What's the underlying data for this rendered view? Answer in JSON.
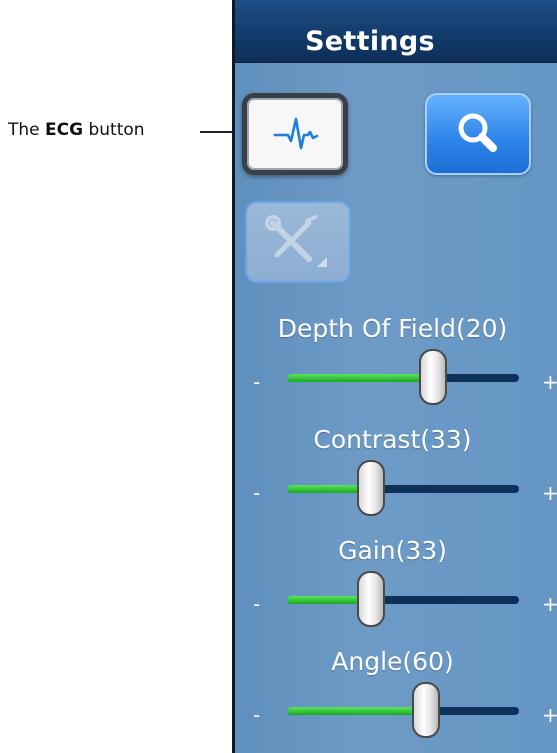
{
  "callout": {
    "prefix": "The ",
    "bold": "ECG",
    "suffix": " button"
  },
  "panel": {
    "title": "Settings"
  },
  "buttons": {
    "ecg": {
      "icon": "ecg-waveform-icon",
      "color": "#1e7fd8"
    },
    "search": {
      "icon": "magnifier-icon"
    },
    "tools": {
      "icon": "wrench-screwdriver-icon"
    }
  },
  "sliders": [
    {
      "label": "Depth Of Field(20)",
      "minus": "-",
      "plus": "+",
      "level": 0.63
    },
    {
      "label": "Contrast(33)",
      "minus": "-",
      "plus": "+",
      "level": 0.36
    },
    {
      "label": "Gain(33)",
      "minus": "-",
      "plus": "+",
      "level": 0.36
    },
    {
      "label": "Angle(60)",
      "minus": "-",
      "plus": "+",
      "level": 0.6
    }
  ],
  "colors": {
    "header": "#123a69",
    "panel": "#6a98c4",
    "fill": "#2fbf2f",
    "track": "#0d3158",
    "accent": "#2f86ea"
  }
}
